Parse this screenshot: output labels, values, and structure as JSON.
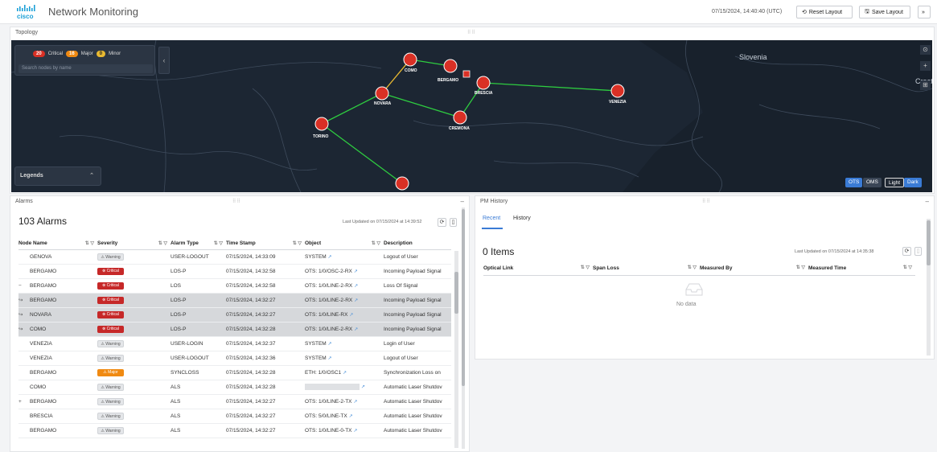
{
  "app": {
    "brand": "cisco",
    "title": "Network Monitoring"
  },
  "header": {
    "timestamp": "07/15/2024, 14:40:40 (UTC)",
    "reset_label": "Reset Layout",
    "save_label": "Save Layout",
    "expand_label": "»"
  },
  "topology": {
    "title": "Topology",
    "alarm_summary": {
      "critical_count": "20",
      "critical_label": "Critical",
      "major_count": "16",
      "major_label": "Major",
      "minor_count": "0",
      "minor_label": "Minor"
    },
    "search_placeholder": "Search nodes by name",
    "legends_label": "Legends",
    "map_labels": {
      "country_1": "Slovenia",
      "country_2": "Croati"
    },
    "nodes": [
      "COMO",
      "BERGAMO",
      "BRESCIA",
      "VENEZIA",
      "NOVARA",
      "CREMONA",
      "TORINO",
      "GENOVA"
    ],
    "view_toggles": [
      "OTS",
      "OMS"
    ],
    "theme_toggles": [
      "Light",
      "Dark"
    ],
    "colors": {
      "map_bg": "#1c2633",
      "link_ok": "#2ecc40",
      "link_warn": "#e8b931",
      "node": "#d93025",
      "toggle_active": "#3a7bd5"
    }
  },
  "alarms": {
    "panel_title": "Alarms",
    "count_label": "103 Alarms",
    "last_updated": "Last Updated on 07/15/2024 at 14:39:52",
    "columns": [
      "Node Name",
      "Severity",
      "Alarm Type",
      "Time Stamp",
      "Object",
      "Description"
    ],
    "rows": [
      {
        "expander": "",
        "node": "GENOVA",
        "severity": "Warning",
        "sev_class": "warning",
        "type": "USER-LOGOUT",
        "time": "07/15/2024, 14:33:09",
        "object": "SYSTEM",
        "desc": "Logout of User",
        "selected": false
      },
      {
        "expander": "",
        "node": "BERGAMO",
        "severity": "Critical",
        "sev_class": "critical",
        "type": "LOS-P",
        "time": "07/15/2024, 14:32:58",
        "object": "OTS: 1/0/OSC-2-RX",
        "desc": "Incoming Payload Signal",
        "selected": false
      },
      {
        "expander": "−",
        "node": "BERGAMO",
        "severity": "Critical",
        "sev_class": "critical",
        "type": "LOS",
        "time": "07/15/2024, 14:32:58",
        "object": "OTS: 1/0/LINE-2-RX",
        "desc": "Loss Of Signal",
        "selected": false
      },
      {
        "expander": "↪",
        "node": "BERGAMO",
        "severity": "Critical",
        "sev_class": "critical",
        "type": "LOS-P",
        "time": "07/15/2024, 14:32:27",
        "object": "OTS: 1/0/LINE-2-RX",
        "desc": "Incoming Payload Signal",
        "selected": true
      },
      {
        "expander": "↪",
        "node": "NOVARA",
        "severity": "Critical",
        "sev_class": "critical",
        "type": "LOS-P",
        "time": "07/15/2024, 14:32:27",
        "object": "OTS: 1/0/LINE-RX",
        "desc": "Incoming Payload Signal",
        "selected": true
      },
      {
        "expander": "↪",
        "node": "COMO",
        "severity": "Critical",
        "sev_class": "critical",
        "type": "LOS-P",
        "time": "07/15/2024, 14:32:28",
        "object": "OTS: 1/0/LINE-2-RX",
        "desc": "Incoming Payload Signal",
        "selected": true
      },
      {
        "expander": "",
        "node": "VENEZIA",
        "severity": "Warning",
        "sev_class": "warning",
        "type": "USER-LOGIN",
        "time": "07/15/2024, 14:32:37",
        "object": "SYSTEM",
        "desc": "Login of User",
        "selected": false
      },
      {
        "expander": "",
        "node": "VENEZIA",
        "severity": "Warning",
        "sev_class": "warning",
        "type": "USER-LOGOUT",
        "time": "07/15/2024, 14:32:36",
        "object": "SYSTEM",
        "desc": "Logout of User",
        "selected": false
      },
      {
        "expander": "",
        "node": "BERGAMO",
        "severity": "Major",
        "sev_class": "major",
        "type": "SYNCLOSS",
        "time": "07/15/2024, 14:32:28",
        "object": "ETH: 1/0/OSC1",
        "desc": "Synchronization Loss on",
        "selected": false
      },
      {
        "expander": "",
        "node": "COMO",
        "severity": "Warning",
        "sev_class": "warning",
        "type": "ALS",
        "time": "07/15/2024, 14:32:28",
        "object": "",
        "desc": "Automatic Laser Shutdov",
        "selected": false
      },
      {
        "expander": "+",
        "node": "BERGAMO",
        "severity": "Warning",
        "sev_class": "warning",
        "type": "ALS",
        "time": "07/15/2024, 14:32:27",
        "object": "OTS: 1/0/LINE-2-TX",
        "desc": "Automatic Laser Shutdov",
        "selected": false
      },
      {
        "expander": "",
        "node": "BRESCIA",
        "severity": "Warning",
        "sev_class": "warning",
        "type": "ALS",
        "time": "07/15/2024, 14:32:27",
        "object": "OTS: 5/0/LINE-TX",
        "desc": "Automatic Laser Shutdov",
        "selected": false
      },
      {
        "expander": "",
        "node": "BERGAMO",
        "severity": "Warning",
        "sev_class": "warning",
        "type": "ALS",
        "time": "07/15/2024, 14:32:27",
        "object": "OTS: 1/0/LINE-0-TX",
        "desc": "Automatic Laser Shutdov",
        "selected": false
      }
    ]
  },
  "pm_history": {
    "panel_title": "PM History",
    "tabs": [
      "Recent",
      "History"
    ],
    "count_label": "0 Items",
    "last_updated": "Last Updated on 07/15/2024 at 14:35:38",
    "columns": [
      "Optical Link",
      "Span Loss",
      "Measured By",
      "Measured Time"
    ],
    "empty_text": "No data"
  }
}
